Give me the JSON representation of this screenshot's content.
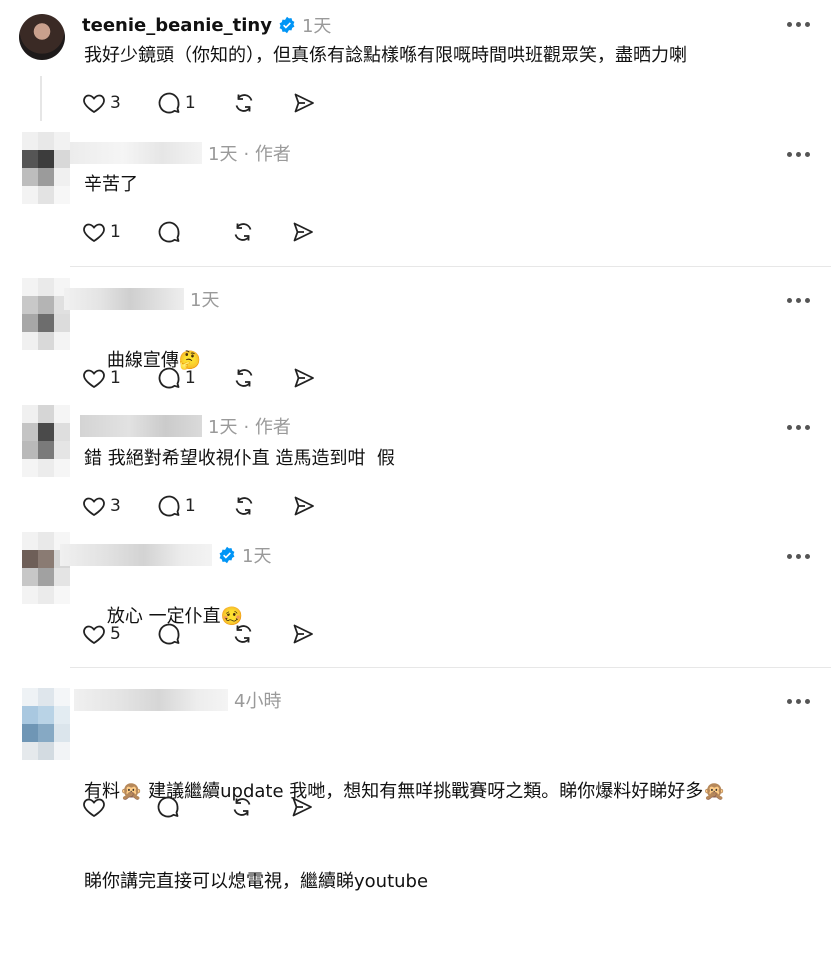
{
  "main_post": {
    "username": "teenie_beanie_tiny",
    "time": "1天",
    "text": "我好少鏡頭（你知的），但真係有諗點樣喺有限嘅時間哄班觀眾笑，盡晒力喇",
    "likes": "3",
    "replies": "1"
  },
  "comments": [
    {
      "username": "",
      "time": "1天",
      "author_tag": "· 作者",
      "text": "辛苦了",
      "likes": "1",
      "replies": ""
    },
    {
      "username": "",
      "time": "1天",
      "author_tag": "",
      "text": "曲線宣傳",
      "emoji": "🤔",
      "likes": "1",
      "replies": "1"
    },
    {
      "username": "",
      "time": "1天",
      "author_tag": "· 作者",
      "text": "錯 我絕對希望收視仆直 造馬造到咁  假",
      "likes": "3",
      "replies": "1"
    },
    {
      "username": "",
      "time": "1天",
      "author_tag": "",
      "text": "放心 一定仆直",
      "emoji": "🥴",
      "likes": "5",
      "replies": ""
    },
    {
      "username": "",
      "time": "4小時",
      "author_tag": "",
      "text_line1": "有料🙊 建議繼續update 我哋，想知有無咩挑戰賽呀之類。睇你爆料好睇好多🙊",
      "text_line2": "睇你講完直接可以熄電視，繼續睇youtube",
      "likes": "",
      "replies": ""
    }
  ],
  "colors": {
    "verified": "#0095f6",
    "muted": "#9a9a9a",
    "divider": "#e7e7e7"
  },
  "icons": [
    "heart-icon",
    "comment-icon",
    "repost-icon",
    "share-icon",
    "more-icon",
    "verified-icon"
  ]
}
